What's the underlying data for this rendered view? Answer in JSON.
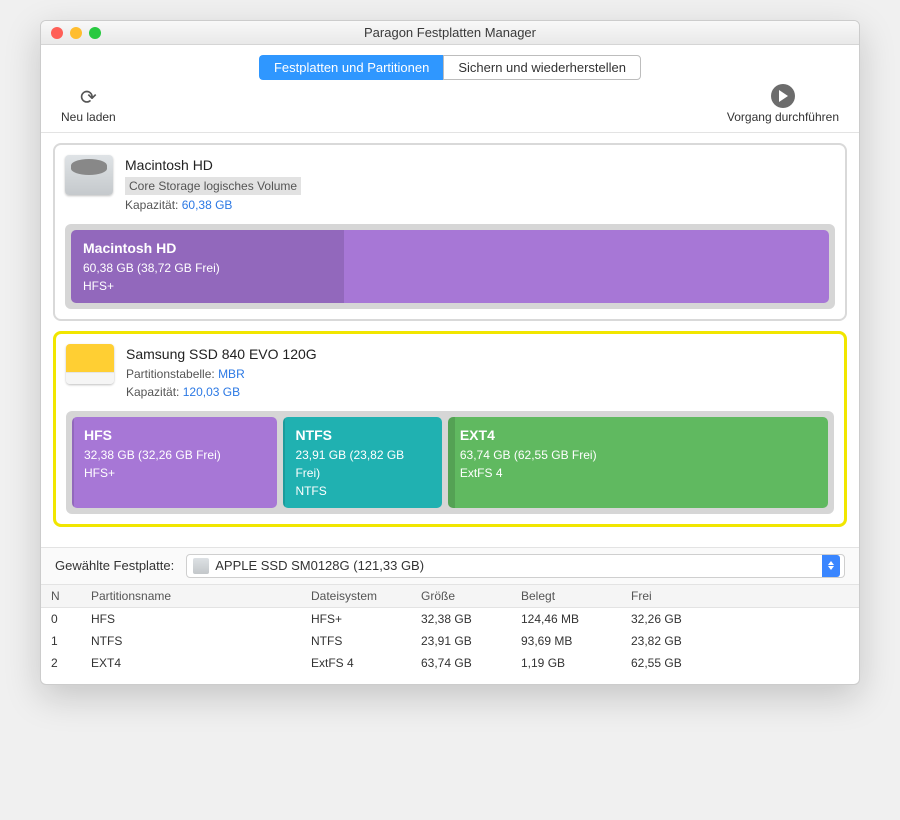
{
  "window": {
    "title": "Paragon Festplatten Manager"
  },
  "tabs": {
    "left": "Festplatten und Partitionen",
    "right": "Sichern und wiederherstellen"
  },
  "toolbar": {
    "reload": "Neu laden",
    "run": "Vorgang durchführen"
  },
  "labels": {
    "capacity": "Kapazität:",
    "partition_table": "Partitionstabelle:",
    "selected_disk": "Gewählte Festplatte:"
  },
  "disks": [
    {
      "name": "Macintosh HD",
      "subtitle": "Core Storage logisches Volume",
      "capacity": "60,38 GB",
      "partitions": [
        {
          "name": "Macintosh HD",
          "size_line": "60,38 GB (38,72 GB Frei)",
          "fs": "HFS+",
          "color": "purple",
          "width_pct": 100,
          "fill_pct": 36
        }
      ]
    },
    {
      "name": "Samsung SSD 840 EVO 120G",
      "table": "MBR",
      "capacity": "120,03 GB",
      "partitions": [
        {
          "name": "HFS",
          "size_line": "32,38 GB (32,26 GB Frei)",
          "fs": "HFS+",
          "color": "purple",
          "width_pct": 27,
          "fill_pct": 1
        },
        {
          "name": "NTFS",
          "size_line": "23,91 GB (23,82 GB Frei)",
          "fs": "NTFS",
          "color": "teal",
          "width_pct": 20,
          "fill_pct": 1
        },
        {
          "name": "EXT4",
          "size_line": "63,74 GB (62,55 GB Frei)",
          "fs": "ExtFS 4",
          "color": "green",
          "width_pct": 53,
          "fill_pct": 2
        }
      ]
    }
  ],
  "selected_disk_label": "APPLE SSD SM0128G (121,33 GB)",
  "table": {
    "headers": {
      "n": "N",
      "name": "Partitionsname",
      "fs": "Dateisystem",
      "size": "Größe",
      "used": "Belegt",
      "free": "Frei"
    },
    "rows": [
      {
        "n": "0",
        "name": "HFS",
        "fs": "HFS+",
        "size": "32,38 GB",
        "used": "124,46 MB",
        "free": "32,26 GB"
      },
      {
        "n": "1",
        "name": "NTFS",
        "fs": "NTFS",
        "size": "23,91 GB",
        "used": "93,69 MB",
        "free": "23,82 GB"
      },
      {
        "n": "2",
        "name": "EXT4",
        "fs": "ExtFS 4",
        "size": "63,74 GB",
        "used": "1,19 GB",
        "free": "62,55 GB"
      }
    ]
  }
}
